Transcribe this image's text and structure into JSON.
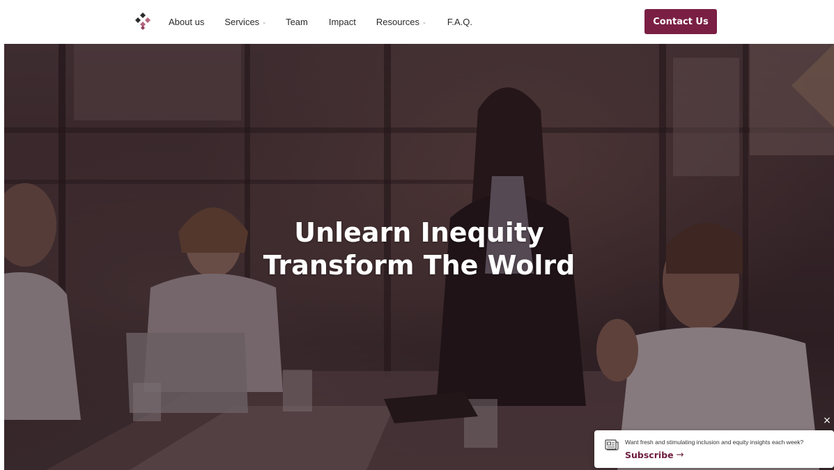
{
  "header": {
    "logo_icon": "diamond-cluster-logo-icon",
    "nav": [
      {
        "label": "About us",
        "dropdown": false
      },
      {
        "label": "Services",
        "dropdown": true
      },
      {
        "label": "Team",
        "dropdown": false
      },
      {
        "label": "Impact",
        "dropdown": false
      },
      {
        "label": "Resources",
        "dropdown": true
      },
      {
        "label": "F.A.Q.",
        "dropdown": false
      }
    ],
    "contact_label": "Contact Us"
  },
  "hero": {
    "title_line1": "Unlearn Inequity",
    "title_line2": "Transform The Wolrd"
  },
  "popup": {
    "message": "Want fresh and stimulating inclusion and equity insights each week?",
    "subscribe_label": "Subscribe",
    "subscribe_arrow": "→",
    "close_glyph": "×",
    "icon": "newsletter-icon"
  },
  "colors": {
    "brand": "#7a1f44",
    "subscribe": "#6e1d3e",
    "logo_dark": "#2b2b2b",
    "logo_pink": "#b5677f"
  }
}
